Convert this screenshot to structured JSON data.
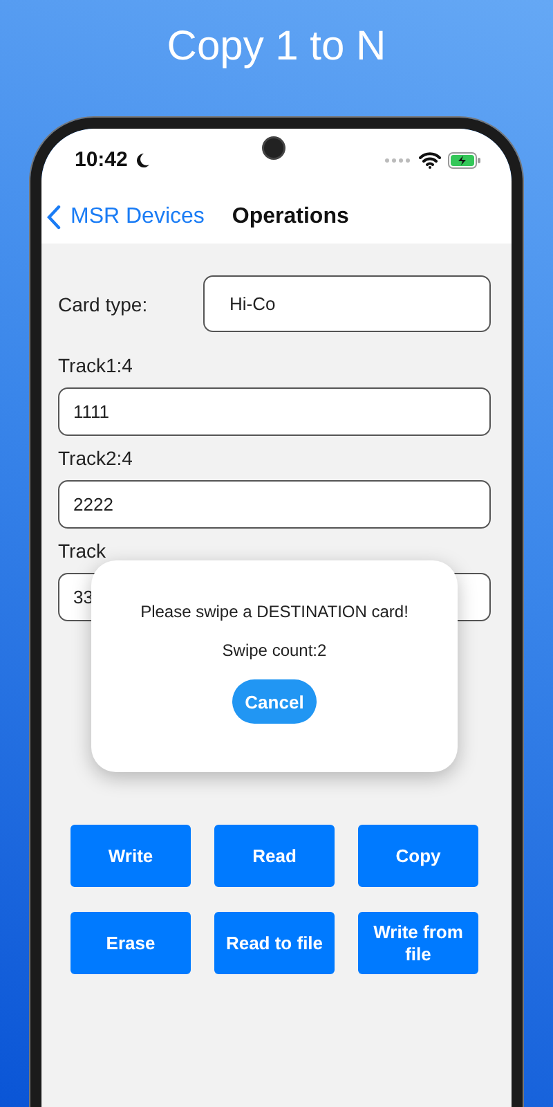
{
  "header": {
    "title": "Copy 1 to N"
  },
  "status_bar": {
    "time": "10:42"
  },
  "nav": {
    "back_label": "MSR Devices",
    "title": "Operations"
  },
  "form": {
    "card_type_label": "Card type:",
    "card_type_value": "Hi-Co",
    "tracks": [
      {
        "label": "Track1:4",
        "value": "1111"
      },
      {
        "label": "Track2:4",
        "value": "2222"
      },
      {
        "label": "Track",
        "value": "33"
      }
    ]
  },
  "dialog": {
    "message": "Please swipe a DESTINATION card!",
    "count": "Swipe count:2",
    "button": "Cancel"
  },
  "buttons": [
    "Write",
    "Read",
    "Copy",
    "Erase",
    "Read to file",
    "Write from file"
  ]
}
